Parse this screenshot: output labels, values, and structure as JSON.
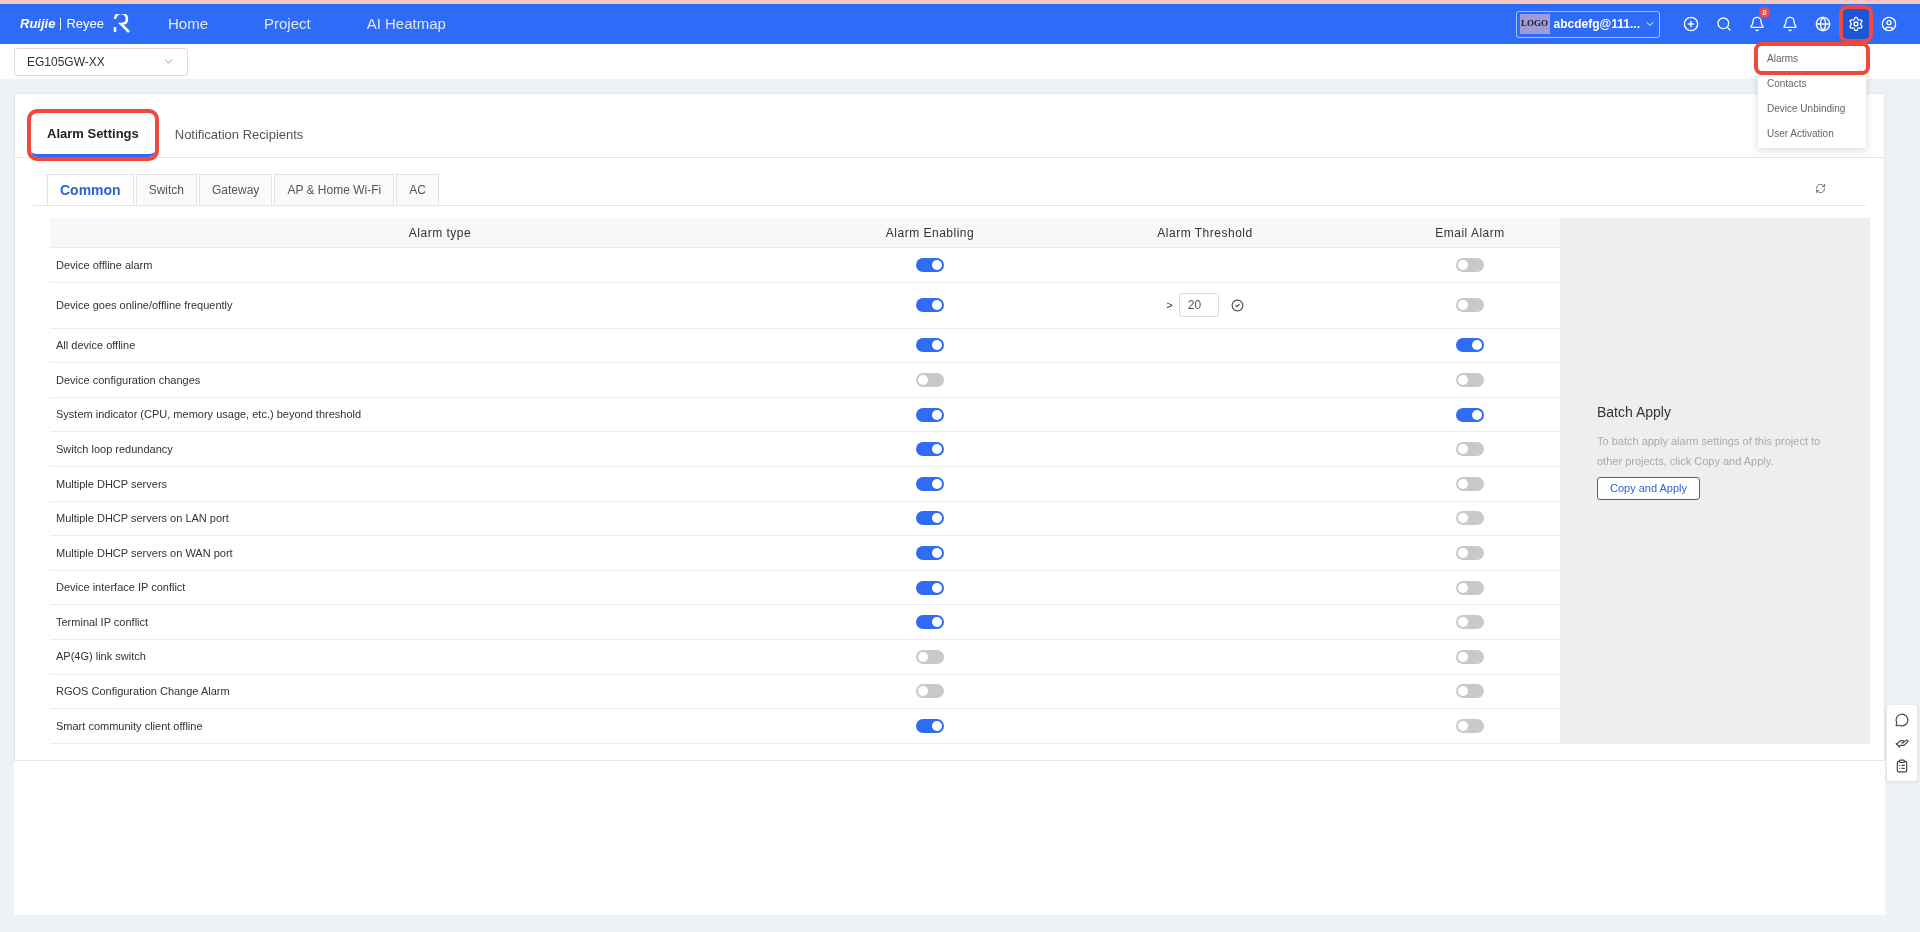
{
  "header": {
    "logo": {
      "brand": "Ruijie",
      "product": "Reyee"
    },
    "nav": [
      "Home",
      "Project",
      "AI Heatmap"
    ],
    "account": {
      "logo": "LOGO",
      "name": "abcdefg@111..."
    },
    "icons": [
      {
        "kind": "add",
        "selected": false,
        "highlighted": false
      },
      {
        "kind": "search",
        "selected": false,
        "highlighted": false
      },
      {
        "kind": "bell",
        "badge": "8",
        "selected": false,
        "highlighted": false
      },
      {
        "kind": "bell",
        "selected": false,
        "highlighted": false
      },
      {
        "kind": "globe",
        "selected": false,
        "highlighted": false
      },
      {
        "kind": "settings",
        "selected": true,
        "highlighted": true
      },
      {
        "kind": "user",
        "selected": false,
        "highlighted": false
      }
    ]
  },
  "settings_menu": [
    {
      "label": "Alarms",
      "highlighted": true
    },
    {
      "label": "Contacts",
      "highlighted": false
    },
    {
      "label": "Device Unbinding",
      "highlighted": false
    },
    {
      "label": "User Activation",
      "highlighted": false
    }
  ],
  "device_select": {
    "value": "EG105GW-XX"
  },
  "tabs": [
    {
      "label": "Alarm Settings",
      "selected": true,
      "highlighted": true
    },
    {
      "label": "Notification Recipients",
      "selected": false,
      "highlighted": false
    }
  ],
  "sub_tabs": [
    {
      "label": "Common",
      "selected": true
    },
    {
      "label": "Switch",
      "selected": false
    },
    {
      "label": "Gateway",
      "selected": false
    },
    {
      "label": "AP & Home Wi-Fi",
      "selected": false
    },
    {
      "label": "AC",
      "selected": false
    }
  ],
  "table": {
    "columns": [
      "Alarm type",
      "Alarm Enabling",
      "Alarm Threshold",
      "Email Alarm"
    ],
    "rows": [
      {
        "type": "Device offline alarm",
        "enabled": true,
        "email": false
      },
      {
        "type": "Device goes online/offline frequently",
        "enabled": true,
        "threshold": {
          "operator": ">",
          "value": "20"
        },
        "email": false
      },
      {
        "type": "All device offline",
        "enabled": true,
        "email": true
      },
      {
        "type": "Device configuration changes",
        "enabled": false,
        "email": false
      },
      {
        "type": "System indicator (CPU, memory usage, etc.) beyond threshold",
        "enabled": true,
        "email": true
      },
      {
        "type": "Switch loop redundancy",
        "enabled": true,
        "email": false
      },
      {
        "type": "Multiple DHCP servers",
        "enabled": true,
        "email": false
      },
      {
        "type": "Multiple DHCP servers on LAN port",
        "enabled": true,
        "email": false
      },
      {
        "type": "Multiple DHCP servers on WAN port",
        "enabled": true,
        "email": false
      },
      {
        "type": "Device interface IP conflict",
        "enabled": true,
        "email": false
      },
      {
        "type": "Terminal IP conflict",
        "enabled": true,
        "email": false
      },
      {
        "type": "AP(4G) link switch",
        "enabled": false,
        "email": false
      },
      {
        "type": "RGOS Configuration Change Alarm",
        "enabled": false,
        "email": false
      },
      {
        "type": "Smart community client offline",
        "enabled": true,
        "email": false
      }
    ]
  },
  "batch_apply": {
    "title": "Batch Apply",
    "description": "To batch apply alarm settings of this project to other projects, click Copy and Apply.",
    "button": "Copy and Apply"
  },
  "float_toolbar": [
    {
      "kind": "chat"
    },
    {
      "kind": "hand"
    },
    {
      "kind": "clipboard"
    }
  ]
}
